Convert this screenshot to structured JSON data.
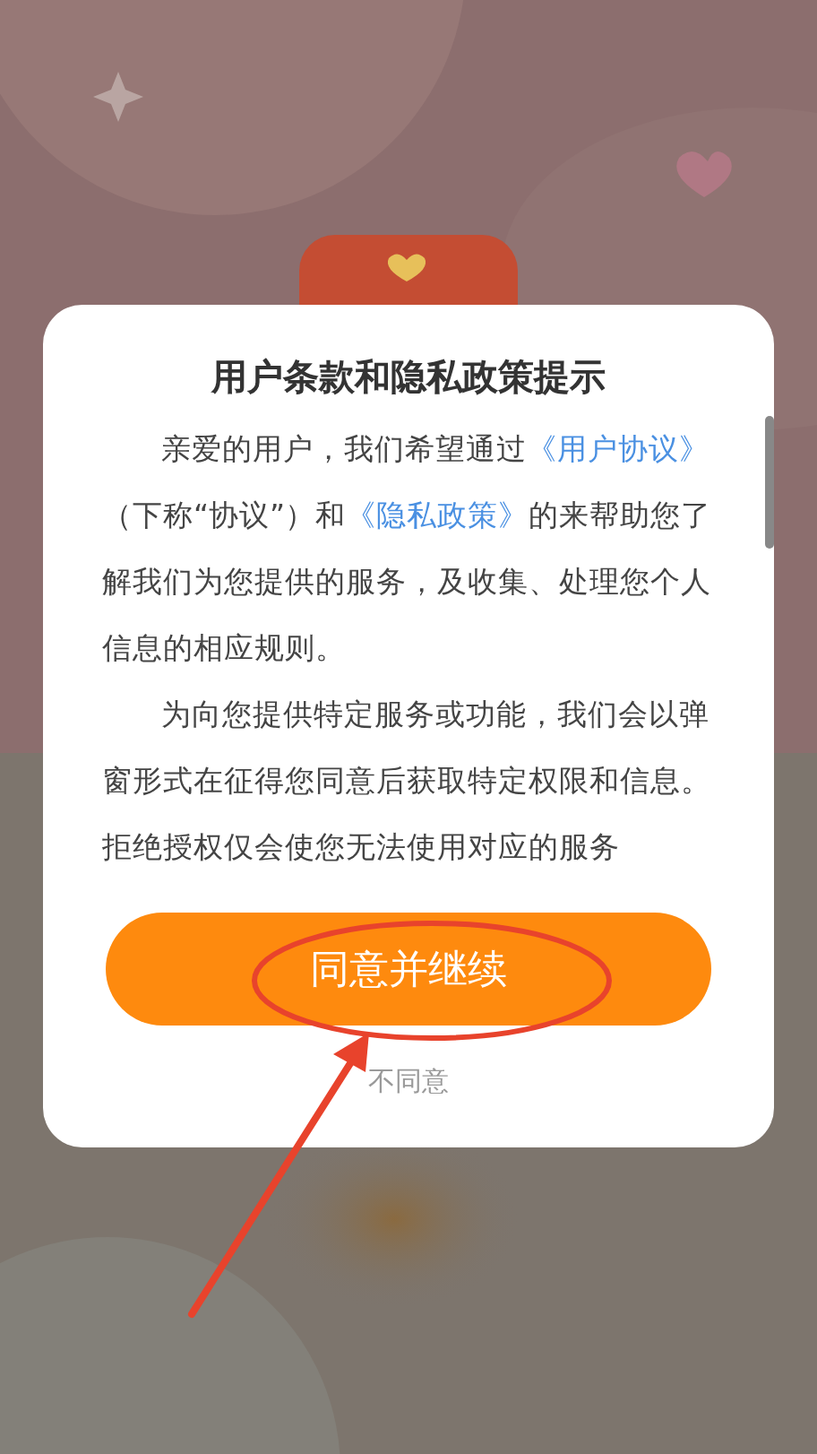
{
  "dialog": {
    "title": "用户条款和隐私政策提示",
    "paragraphs": [
      {
        "parts": [
          {
            "kind": "text",
            "text": "亲爱的用户，我们希望通过"
          },
          {
            "kind": "link",
            "text": "《用户协议》"
          },
          {
            "kind": "text",
            "text": "（下称“协议”）和"
          },
          {
            "kind": "link",
            "text": "《隐私政策》"
          },
          {
            "kind": "text",
            "text": "的来帮助您了解我们为您提供的服务，及收集、处理您个人信息的相应规则。"
          }
        ]
      },
      {
        "parts": [
          {
            "kind": "text",
            "text": "为向您提供特定服务或功能，我们会以弹窗形式在征得您同意后获取特定权限和信息。拒绝授权仅会使您无法使用对应的服务"
          }
        ]
      }
    ],
    "agree_button": "同意并继续",
    "decline_link": "不同意"
  }
}
